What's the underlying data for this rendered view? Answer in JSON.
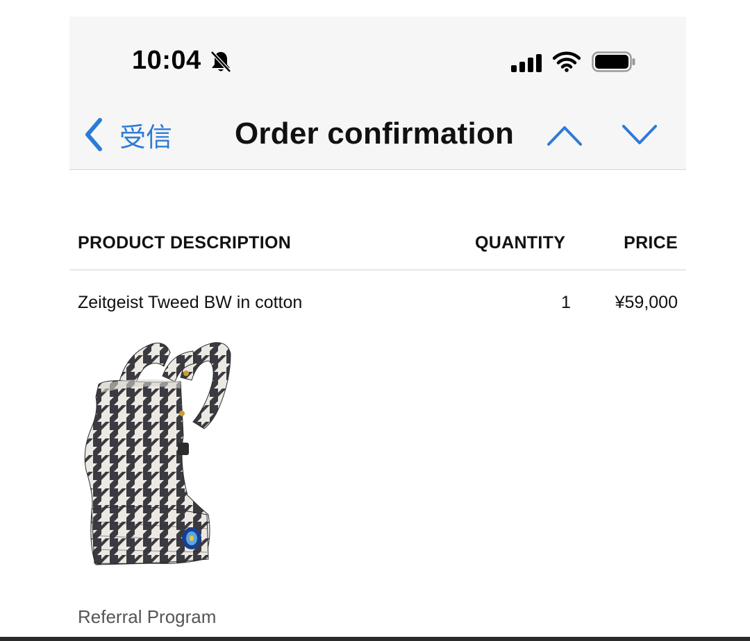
{
  "status_bar": {
    "time": "10:04",
    "icons": [
      "mute-bell-icon",
      "cellular-signal-icon",
      "wifi-icon",
      "battery-icon"
    ]
  },
  "nav": {
    "back_label": "受信",
    "title": "Order confirmation",
    "prev_icon": "chevron-up-icon",
    "next_icon": "chevron-down-icon",
    "accent_color": "#2d7bd6"
  },
  "table": {
    "headers": {
      "description": "PRODUCT DESCRIPTION",
      "quantity": "QUANTITY",
      "price": "PRICE"
    },
    "rows": [
      {
        "description": "Zeitgeist Tweed BW in cotton",
        "quantity": "1",
        "price": "¥59,000"
      }
    ]
  },
  "product_image": {
    "icon": "houndstooth-baby-carrier-image"
  },
  "footer": {
    "text": "Referral Program"
  }
}
